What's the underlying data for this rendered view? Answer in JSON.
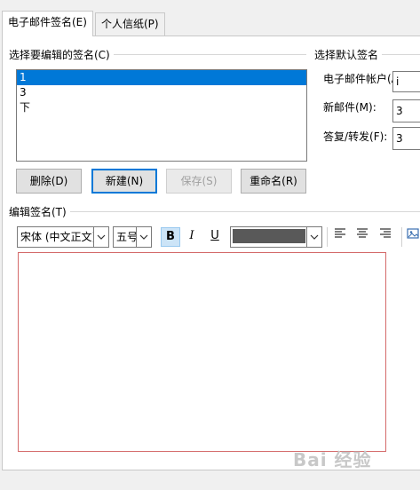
{
  "tabs": [
    {
      "label": "电子邮件签名(E)",
      "active": true
    },
    {
      "label": "个人信纸(P)",
      "active": false
    }
  ],
  "select_signature": {
    "title": "选择要编辑的签名(C)",
    "items": [
      "1",
      "3",
      "下"
    ],
    "selected_index": 0
  },
  "buttons": {
    "delete": "删除(D)",
    "new": "新建(N)",
    "save": "保存(S)",
    "rename": "重命名(R)"
  },
  "default_signature": {
    "title": "选择默认签名",
    "account_label": "电子邮件帐户(A):",
    "account_value": "i",
    "new_messages_label": "新邮件(M):",
    "new_messages_value": "3",
    "replies_label": "答复/转发(F):",
    "replies_value": "3"
  },
  "edit_signature": {
    "title": "编辑签名(T)",
    "font": "宋体 (中文正文)",
    "size": "五号",
    "bold": "B",
    "italic": "I",
    "underline": "U",
    "font_color": "#595959",
    "editor_text": ""
  },
  "watermark": "Bai 经验"
}
